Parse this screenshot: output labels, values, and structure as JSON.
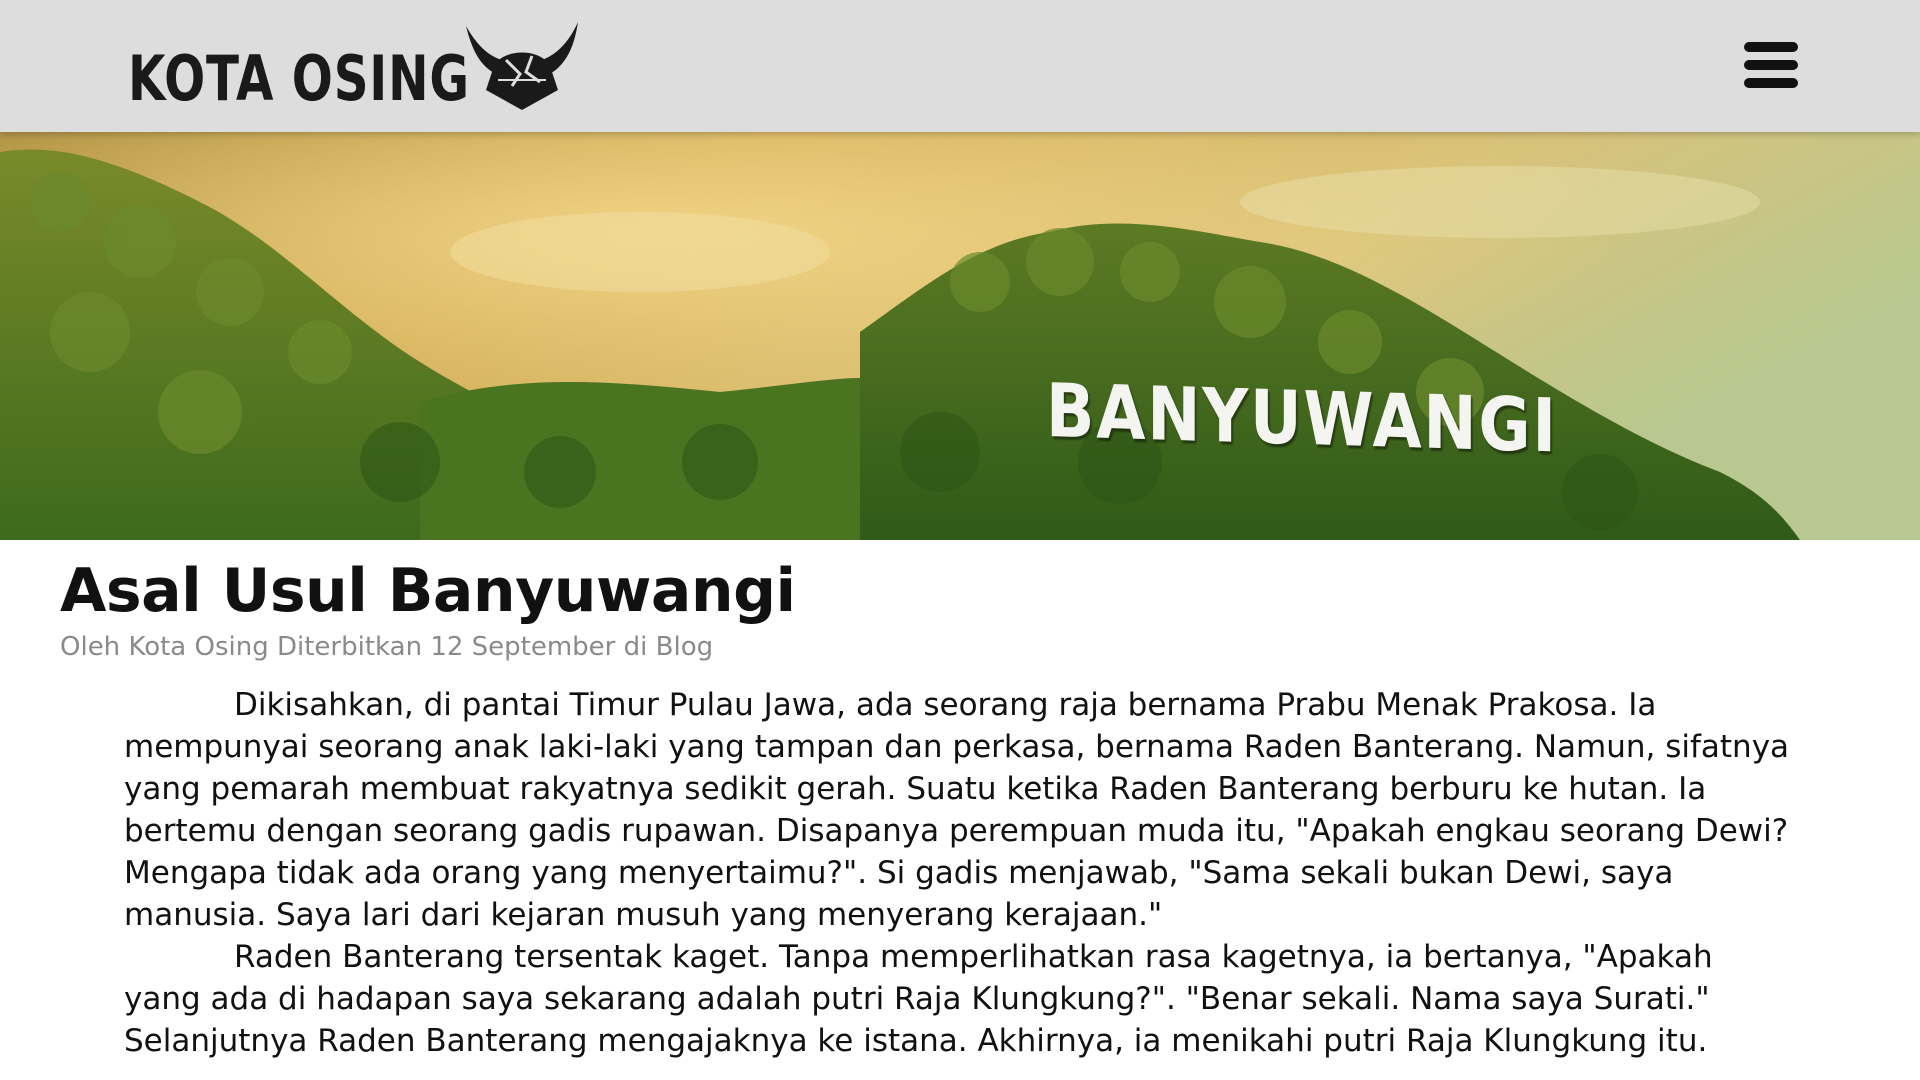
{
  "header": {
    "logo_text": "KOTA OSING",
    "logo_icon": "viking-helmet-icon",
    "menu_icon": "hamburger-menu-icon",
    "background_color": "#dddddd"
  },
  "hero": {
    "sign_text": "BANYUWANGI"
  },
  "article": {
    "title": "Asal Usul Banyuwangi",
    "meta": {
      "by_label": "Oleh",
      "author": "Kota Osing",
      "published_label": "Diterbitkan",
      "date": "12 September",
      "in_label": "di",
      "category": "Blog"
    },
    "paragraphs": [
      "Dikisahkan, di pantai Timur Pulau Jawa, ada seorang raja bernama Prabu Menak Prakosa. Ia mempunyai seorang anak laki-laki yang tampan dan perkasa, bernama Raden Banterang. Namun, sifatnya yang pemarah membuat rakyatnya sedikit gerah. Suatu ketika Raden Banterang berburu ke hutan. Ia bertemu dengan seorang gadis rupawan. Disapanya perempuan muda itu, \"Apakah engkau seorang Dewi? Mengapa tidak ada orang yang menyertaimu?\". Si gadis menjawab, \"Sama sekali bukan Dewi, saya manusia. Saya lari dari kejaran musuh yang menyerang kerajaan.\"",
      "Raden Banterang tersentak kaget. Tanpa memperlihatkan rasa kagetnya, ia bertanya, \"Apakah yang ada di hadapan saya sekarang adalah putri Raja Klungkung?\". \"Benar sekali. Nama saya Surati.\" Selanjutnya Raden Banterang mengajaknya ke istana. Akhirnya, ia menikahi putri Raja Klungkung itu."
    ]
  }
}
